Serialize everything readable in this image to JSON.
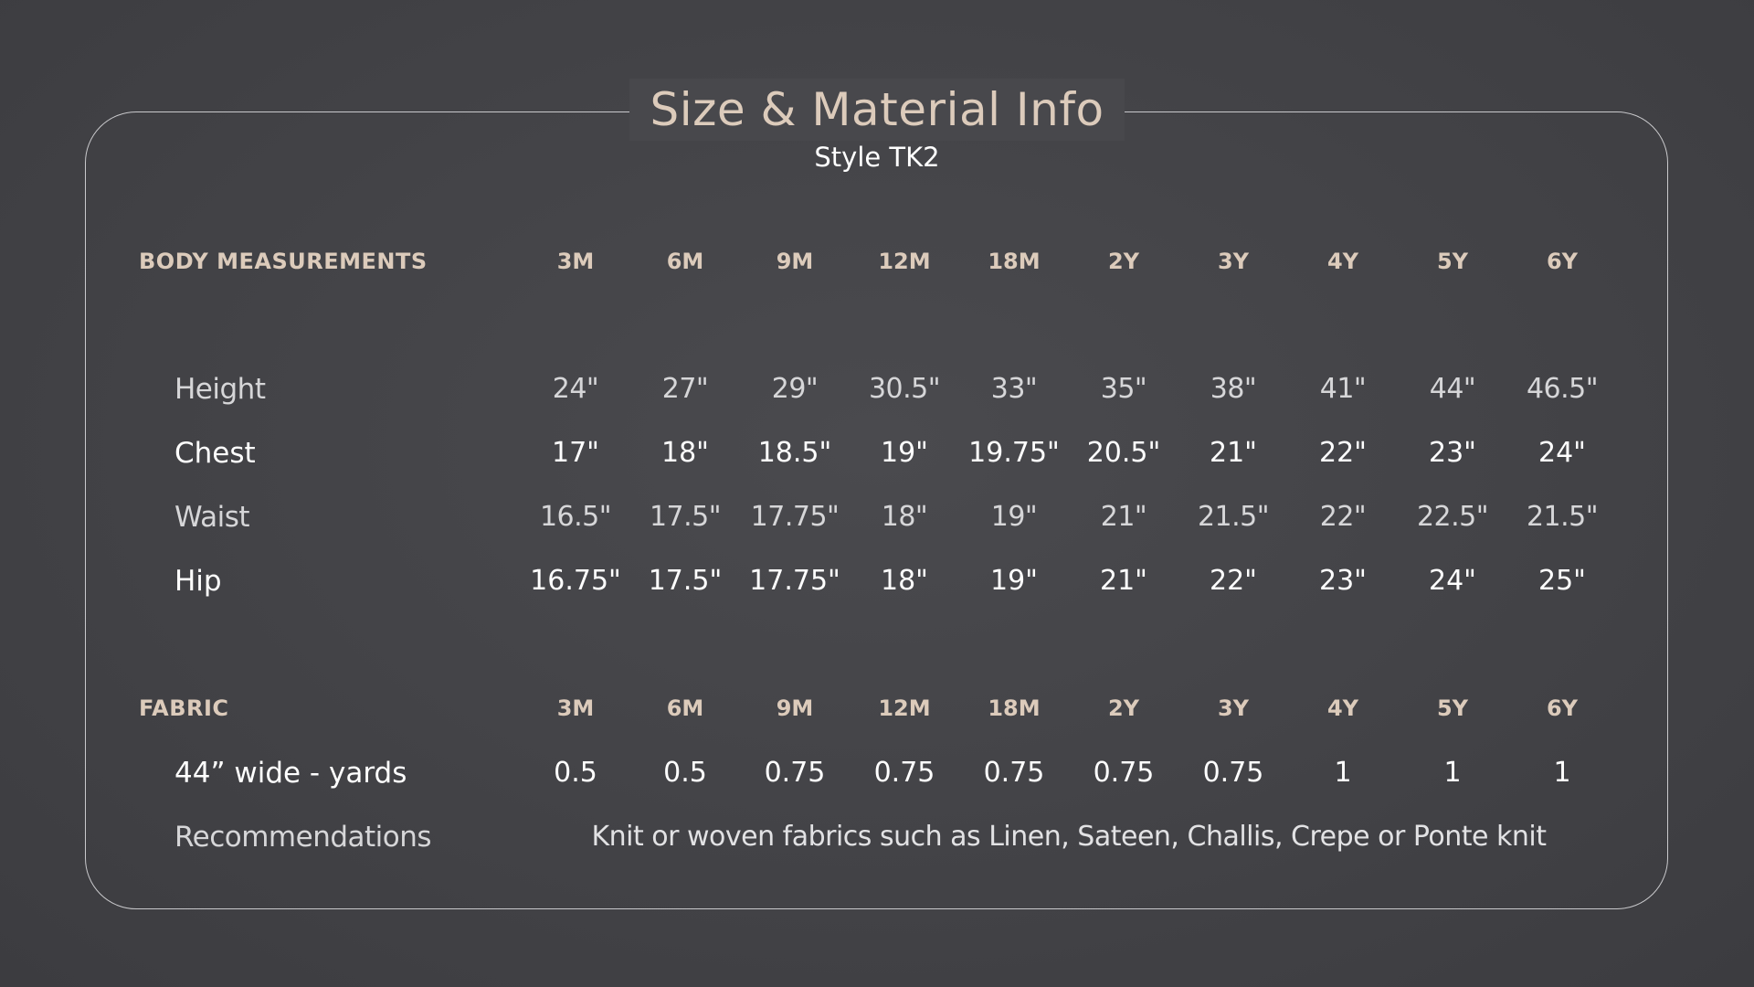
{
  "header": {
    "title": "Size & Material Info",
    "subtitle": "Style TK2"
  },
  "body_measurements": {
    "heading": "BODY MEASUREMENTS",
    "sizes": [
      "3M",
      "6M",
      "9M",
      "12M",
      "18M",
      "2Y",
      "3Y",
      "4Y",
      "5Y",
      "6Y"
    ],
    "rows": [
      {
        "label": "Height",
        "values": [
          "24\"",
          "27\"",
          "29\"",
          "30.5\"",
          "33\"",
          "35\"",
          "38\"",
          "41\"",
          "44\"",
          "46.5\""
        ]
      },
      {
        "label": "Chest",
        "values": [
          "17\"",
          "18\"",
          "18.5\"",
          "19\"",
          "19.75\"",
          "20.5\"",
          "21\"",
          "22\"",
          "23\"",
          "24\""
        ]
      },
      {
        "label": "Waist",
        "values": [
          "16.5\"",
          "17.5\"",
          "17.75\"",
          "18\"",
          "19\"",
          "21\"",
          "21.5\"",
          "22\"",
          "22.5\"",
          "21.5\""
        ]
      },
      {
        "label": "Hip",
        "values": [
          "16.75\"",
          "17.5\"",
          "17.75\"",
          "18\"",
          "19\"",
          "21\"",
          "22\"",
          "23\"",
          "24\"",
          "25\""
        ]
      }
    ]
  },
  "fabric": {
    "heading": "FABRIC",
    "sizes": [
      "3M",
      "6M",
      "9M",
      "12M",
      "18M",
      "2Y",
      "3Y",
      "4Y",
      "5Y",
      "6Y"
    ],
    "yardage": {
      "label": "44” wide - yards",
      "values": [
        "0.5",
        "0.5",
        "0.75",
        "0.75",
        "0.75",
        "0.75",
        "0.75",
        "1",
        "1",
        "1"
      ]
    },
    "recommendations": {
      "label": "Recommendations",
      "text": "Knit or woven fabrics such as Linen, Sateen, Challis, Crepe or Ponte knit"
    }
  },
  "colors": {
    "background": "#47474b",
    "accent": "#dccbbb",
    "border": "#c9c9cc",
    "text": "#ffffff"
  }
}
